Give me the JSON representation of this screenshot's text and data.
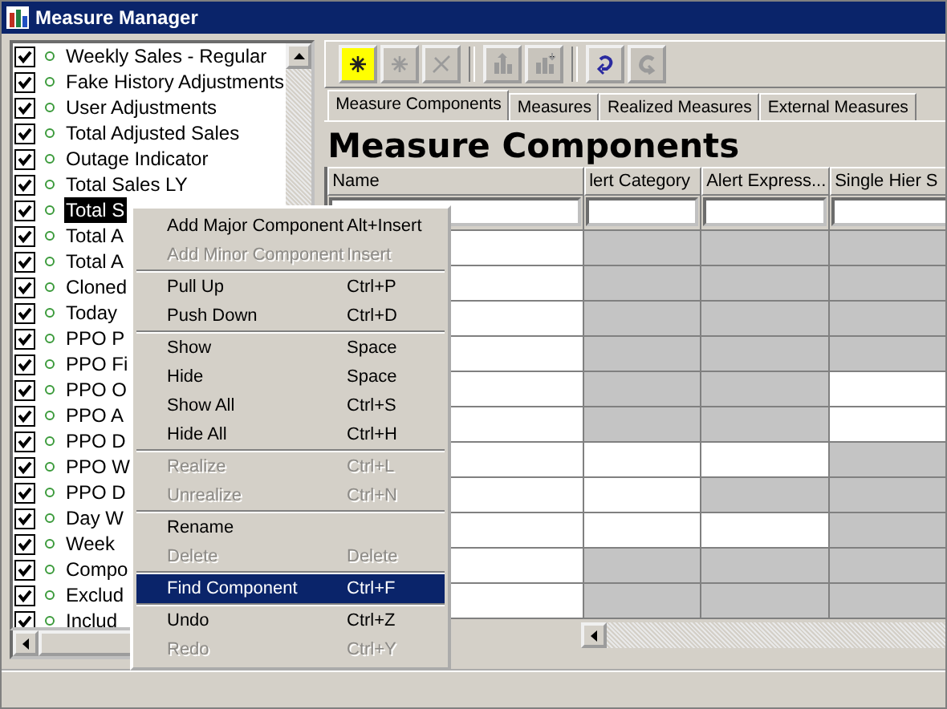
{
  "window": {
    "title": "Measure Manager"
  },
  "measures": [
    {
      "label": "Weekly Sales - Regular",
      "checked": true,
      "selected": false
    },
    {
      "label": "Fake History Adjustments",
      "checked": true,
      "selected": false
    },
    {
      "label": "User Adjustments",
      "checked": true,
      "selected": false
    },
    {
      "label": "Total Adjusted Sales",
      "checked": true,
      "selected": false
    },
    {
      "label": "Outage Indicator",
      "checked": true,
      "selected": false
    },
    {
      "label": "Total Sales LY",
      "checked": true,
      "selected": false
    },
    {
      "label": "Total S",
      "checked": true,
      "selected": true
    },
    {
      "label": "Total A",
      "checked": true,
      "selected": false
    },
    {
      "label": "Total A",
      "checked": true,
      "selected": false
    },
    {
      "label": "Cloned",
      "checked": true,
      "selected": false
    },
    {
      "label": "Today",
      "checked": true,
      "selected": false
    },
    {
      "label": "PPO P",
      "checked": true,
      "selected": false
    },
    {
      "label": "PPO Fi",
      "checked": true,
      "selected": false
    },
    {
      "label": "PPO O",
      "checked": true,
      "selected": false
    },
    {
      "label": "PPO A",
      "checked": true,
      "selected": false
    },
    {
      "label": "PPO D",
      "checked": true,
      "selected": false
    },
    {
      "label": "PPO W",
      "checked": true,
      "selected": false
    },
    {
      "label": "PPO D",
      "checked": true,
      "selected": false
    },
    {
      "label": "Day W",
      "checked": true,
      "selected": false
    },
    {
      "label": "Week",
      "checked": true,
      "selected": false
    },
    {
      "label": "Compo",
      "checked": true,
      "selected": false
    },
    {
      "label": "Exclud",
      "checked": true,
      "selected": false
    },
    {
      "label": "Includ",
      "checked": true,
      "selected": false
    }
  ],
  "toolbar": [
    {
      "kind": "add-major",
      "disabled": false,
      "highlighted": true
    },
    {
      "kind": "add-minor",
      "disabled": true,
      "highlighted": false
    },
    {
      "kind": "delete",
      "disabled": true,
      "highlighted": false
    },
    {
      "kind": "pull-up",
      "disabled": true,
      "highlighted": false
    },
    {
      "kind": "push-down",
      "disabled": true,
      "highlighted": false
    },
    {
      "kind": "undo",
      "disabled": false,
      "highlighted": false
    },
    {
      "kind": "redo",
      "disabled": true,
      "highlighted": false
    }
  ],
  "tabs": [
    {
      "label": "Measure Components",
      "selected": true
    },
    {
      "label": "Measures",
      "selected": false
    },
    {
      "label": "Realized Measures",
      "selected": false
    },
    {
      "label": "External Measures",
      "selected": false
    }
  ],
  "heading": "Measure Components",
  "table": {
    "columns": [
      "Name",
      "lert Category",
      "Alert Express...",
      "Single Hier S"
    ],
    "rows": [
      [
        false,
        false,
        false
      ],
      [
        false,
        false,
        false
      ],
      [
        false,
        false,
        false
      ],
      [
        false,
        false,
        false
      ],
      [
        false,
        false,
        true
      ],
      [
        false,
        false,
        true
      ],
      [
        true,
        true,
        false
      ],
      [
        true,
        false,
        false
      ],
      [
        true,
        true,
        false
      ],
      [
        false,
        false,
        false
      ],
      [
        false,
        false,
        false
      ]
    ]
  },
  "context_menu": [
    {
      "kind": "item",
      "label": "Add Major Component",
      "shortcut": "Alt+Insert",
      "disabled": false,
      "selected": false
    },
    {
      "kind": "item",
      "label": "Add Minor Component",
      "shortcut": "Insert",
      "disabled": true,
      "selected": false
    },
    {
      "kind": "separator"
    },
    {
      "kind": "item",
      "label": "Pull Up",
      "shortcut": "Ctrl+P",
      "disabled": false,
      "selected": false
    },
    {
      "kind": "item",
      "label": "Push Down",
      "shortcut": "Ctrl+D",
      "disabled": false,
      "selected": false
    },
    {
      "kind": "separator"
    },
    {
      "kind": "item",
      "label": "Show",
      "shortcut": "Space",
      "disabled": false,
      "selected": false
    },
    {
      "kind": "item",
      "label": "Hide",
      "shortcut": "Space",
      "disabled": false,
      "selected": false
    },
    {
      "kind": "item",
      "label": "Show All",
      "shortcut": "Ctrl+S",
      "disabled": false,
      "selected": false
    },
    {
      "kind": "item",
      "label": "Hide All",
      "shortcut": "Ctrl+H",
      "disabled": false,
      "selected": false
    },
    {
      "kind": "separator"
    },
    {
      "kind": "item",
      "label": "Realize",
      "shortcut": "Ctrl+L",
      "disabled": true,
      "selected": false
    },
    {
      "kind": "item",
      "label": "Unrealize",
      "shortcut": "Ctrl+N",
      "disabled": true,
      "selected": false
    },
    {
      "kind": "separator"
    },
    {
      "kind": "item",
      "label": "Rename",
      "disabled": false,
      "selected": false
    },
    {
      "kind": "item",
      "label": "Delete",
      "shortcut": "Delete",
      "disabled": true,
      "selected": false
    },
    {
      "kind": "separator"
    },
    {
      "kind": "item",
      "label": "Find Component",
      "shortcut": "Ctrl+F",
      "disabled": false,
      "selected": true
    },
    {
      "kind": "separator"
    },
    {
      "kind": "item",
      "label": "Undo",
      "shortcut": "Ctrl+Z",
      "disabled": false,
      "selected": false
    },
    {
      "kind": "item",
      "label": "Redo",
      "shortcut": "Ctrl+Y",
      "disabled": true,
      "selected": false
    }
  ]
}
